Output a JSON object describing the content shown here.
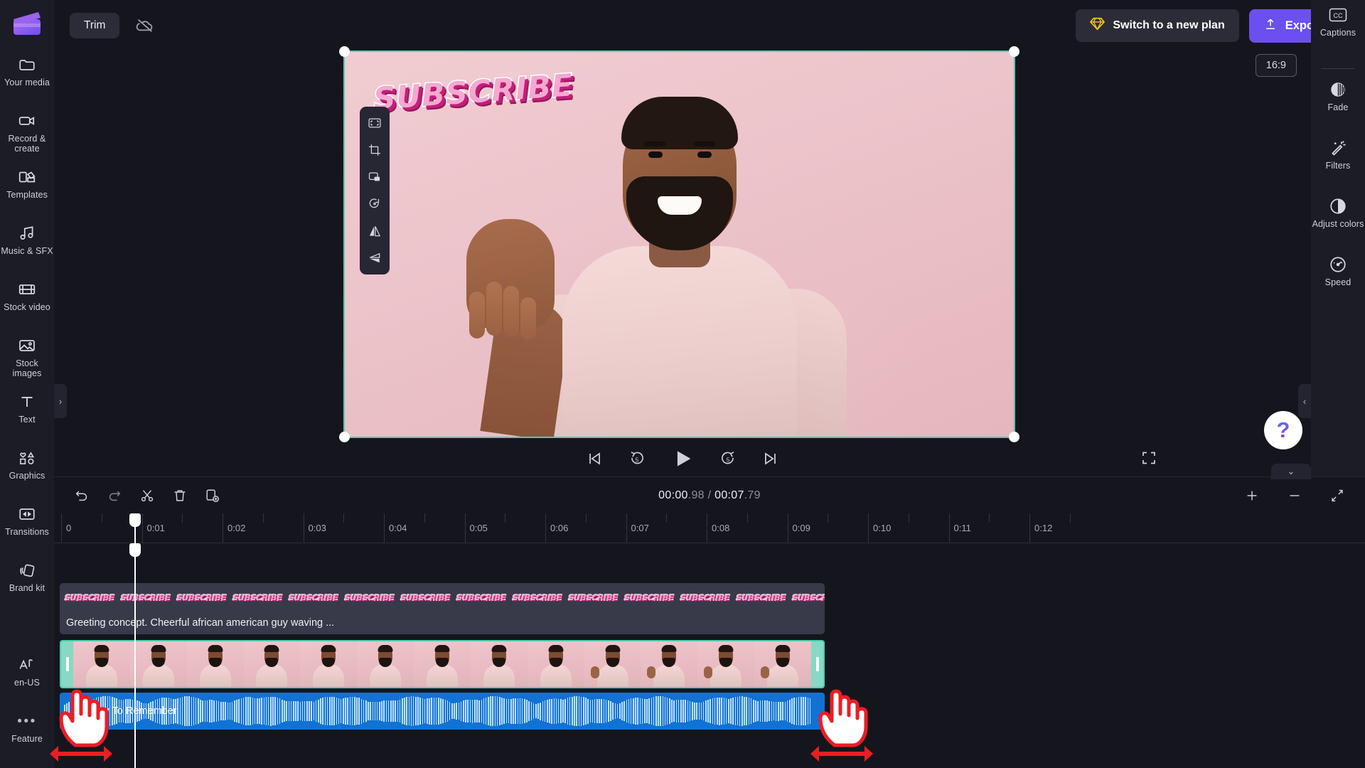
{
  "app": {
    "name": "Clipchamp Video Editor"
  },
  "topbar": {
    "trim_label": "Trim",
    "cloud_icon": "cloud-off-icon",
    "plan_label": "Switch to a new plan",
    "plan_icon": "diamond-icon",
    "export_label": "Export",
    "export_icon": "upload-icon",
    "export_caret": "chevron-down-icon"
  },
  "sidebar": {
    "logo_icon": "clapperboard-logo",
    "items": [
      {
        "label": "Your media",
        "icon": "folder-icon"
      },
      {
        "label": "Record & create",
        "icon": "video-camera-icon"
      },
      {
        "label": "Templates",
        "icon": "templates-icon"
      },
      {
        "label": "Music & SFX",
        "icon": "music-note-icon"
      },
      {
        "label": "Stock video",
        "icon": "film-strip-icon"
      },
      {
        "label": "Stock images",
        "icon": "image-icon"
      },
      {
        "label": "Text",
        "icon": "text-t-icon"
      },
      {
        "label": "Graphics",
        "icon": "shapes-icon"
      },
      {
        "label": "Transitions",
        "icon": "transitions-icon"
      },
      {
        "label": "Brand kit",
        "icon": "brand-kit-icon"
      }
    ],
    "bottom_items": [
      {
        "label": "en-US",
        "icon": "language-icon"
      },
      {
        "label": "Feature",
        "icon": "more-dots-icon"
      }
    ],
    "expand_icon": "chevron-right-icon"
  },
  "right_panel": {
    "captions_label": "Captions",
    "captions_icon": "cc-icon",
    "items": [
      {
        "label": "Fade",
        "icon": "fade-icon"
      },
      {
        "label": "Filters",
        "icon": "magic-wand-icon"
      },
      {
        "label": "Adjust colors",
        "icon": "contrast-icon"
      },
      {
        "label": "Speed",
        "icon": "speedometer-icon"
      }
    ],
    "collapse_icon": "chevron-left-icon"
  },
  "preview": {
    "aspect_ratio": "16:9",
    "sticker_text": "SUBSCRIBE",
    "object_toolbar": [
      {
        "icon": "fit-to-screen-icon"
      },
      {
        "icon": "crop-icon"
      },
      {
        "icon": "picture-in-picture-icon"
      },
      {
        "icon": "rotate-icon"
      },
      {
        "icon": "flip-horizontal-icon"
      },
      {
        "icon": "flip-vertical-icon"
      }
    ],
    "controls": [
      {
        "icon": "skip-to-start-icon"
      },
      {
        "icon": "rewind-5-icon"
      },
      {
        "icon": "play-icon"
      },
      {
        "icon": "forward-5-icon"
      },
      {
        "icon": "skip-to-end-icon"
      }
    ],
    "fullscreen_icon": "fullscreen-icon",
    "help_icon": "help-question-icon",
    "collapse_down_icon": "chevron-down-icon"
  },
  "timeline": {
    "tools": [
      {
        "icon": "undo-icon"
      },
      {
        "icon": "redo-icon"
      },
      {
        "icon": "split-scissors-icon"
      },
      {
        "icon": "delete-trash-icon"
      },
      {
        "icon": "duplicate-icon"
      }
    ],
    "current_time": "00:00",
    "current_time_frac": ".98",
    "separator": " / ",
    "total_time": "00:07",
    "total_time_frac": ".79",
    "right_tools": [
      {
        "icon": "zoom-in-plus-icon"
      },
      {
        "icon": "zoom-out-minus-icon"
      },
      {
        "icon": "fit-timeline-icon"
      }
    ],
    "ruler_labels": [
      "0",
      "0:01",
      "0:02",
      "0:03",
      "0:04",
      "0:05",
      "0:06",
      "0:07",
      "0:08",
      "0:09",
      "0:10",
      "0:11",
      "0:12"
    ],
    "playhead_time": "0:01",
    "text_clip": {
      "caption": "Greeting concept. Cheerful african american guy waving ...",
      "sticker_label": "SUBSCRIBE",
      "sticker_count": 15
    },
    "video_clip": {
      "handle_icon": "trim-handle-icon"
    },
    "audio_clip": {
      "name": "Day To Remember"
    }
  },
  "annotations": {
    "cursor_icon": "pointing-hand-cursor",
    "arrow_icon": "double-arrow-horizontal",
    "accent_red": "#ee1c25",
    "accent_teal": "#4bd0b0",
    "accent_purple": "#6c4ff0",
    "accent_gold": "#f5c518",
    "audio_blue": "#1172d4"
  }
}
